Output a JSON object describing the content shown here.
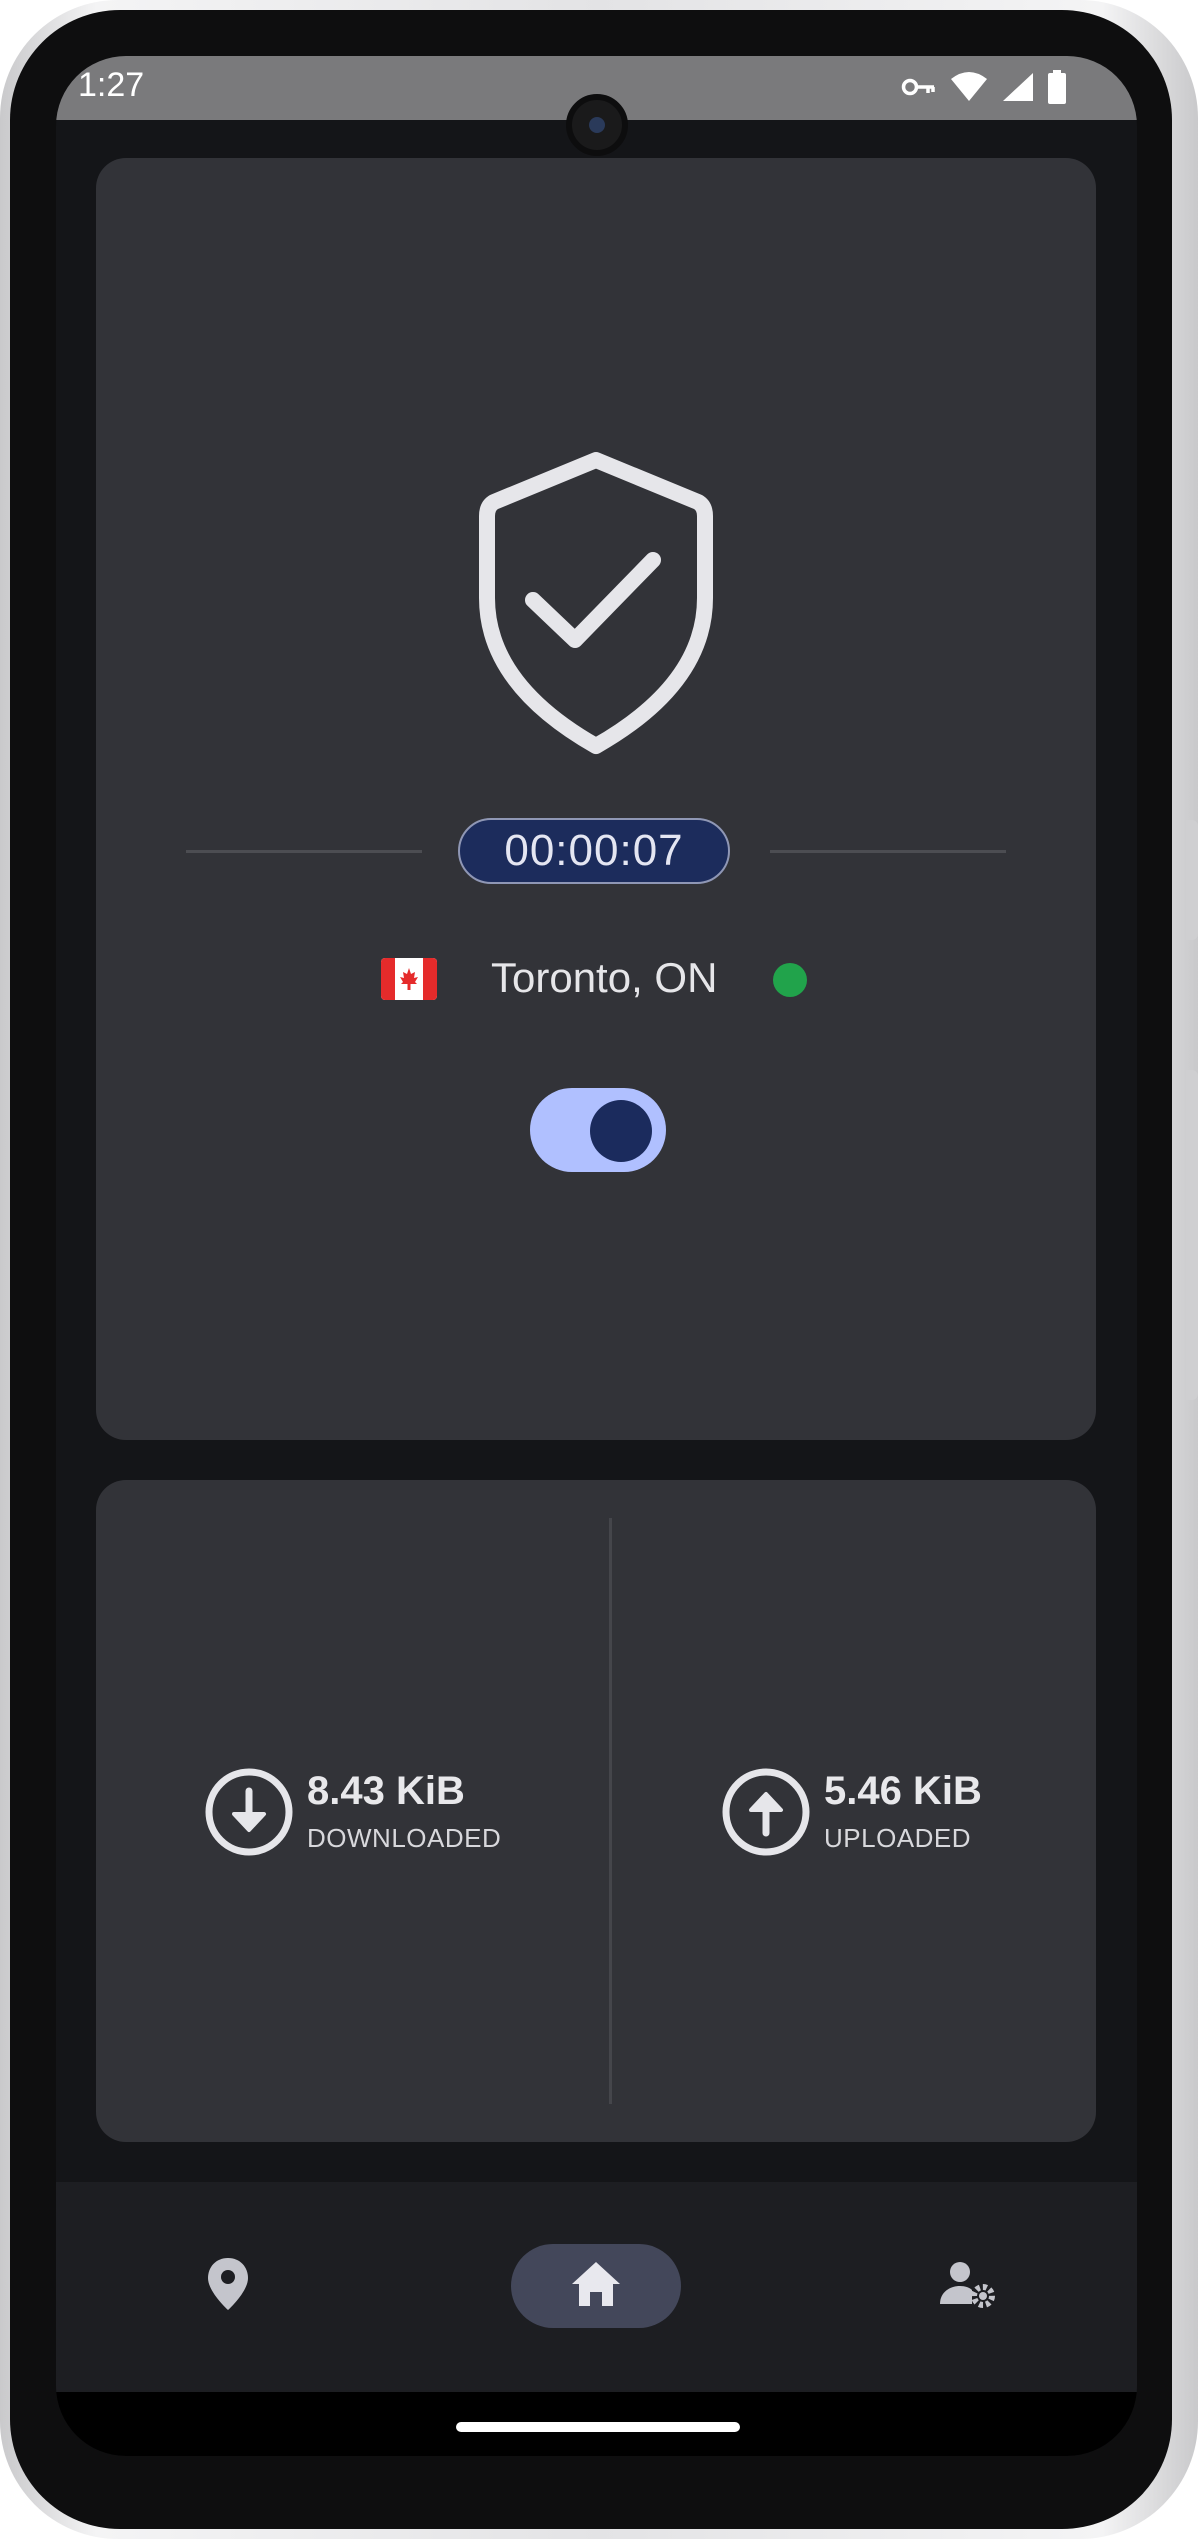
{
  "status_bar": {
    "time": "1:27",
    "icons": [
      "vpn-key-icon",
      "wifi-icon",
      "cellular-signal-icon",
      "battery-icon"
    ]
  },
  "connection": {
    "shield_icon": "shield-check-icon",
    "timer": "00:00:07",
    "location": "Toronto, ON",
    "flag_icon": "canada-flag-icon",
    "status_color": "#21a34b",
    "toggle_on": true
  },
  "stats": {
    "download": {
      "icon": "download-arrow-icon",
      "value": "8.43 KiB",
      "label": "DOWNLOADED"
    },
    "upload": {
      "icon": "upload-arrow-icon",
      "value": "5.46 KiB",
      "label": "UPLOADED"
    }
  },
  "nav": {
    "items": [
      {
        "name": "locations",
        "icon": "location-pin-icon",
        "active": false
      },
      {
        "name": "home",
        "icon": "home-icon",
        "active": true
      },
      {
        "name": "account-settings",
        "icon": "user-settings-icon",
        "active": false
      }
    ]
  },
  "colors": {
    "background": "#141518",
    "card": "#323338",
    "accent": "#b0c0ff",
    "timer_bg": "#1c2c5c",
    "connected": "#21a34b"
  }
}
